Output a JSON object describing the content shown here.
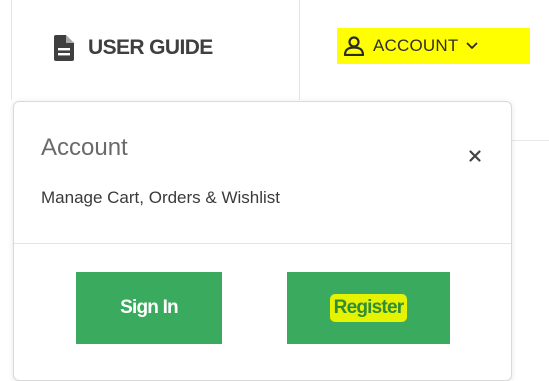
{
  "nav": {
    "user_guide": {
      "label": "USER GUIDE",
      "icon": "document-icon"
    },
    "account": {
      "label": "ACCOUNT",
      "icon": "user-icon",
      "chevron": "chevron-down-icon",
      "highlight_color": "#ffff00"
    }
  },
  "dropdown": {
    "title": "Account",
    "subtitle": "Manage Cart, Orders & Wishlist",
    "close_icon": "close-icon",
    "sign_in_label": "Sign In",
    "register_label": "Register",
    "button_color": "#3aaa5e",
    "register_highlight_color": "#e5f200"
  }
}
